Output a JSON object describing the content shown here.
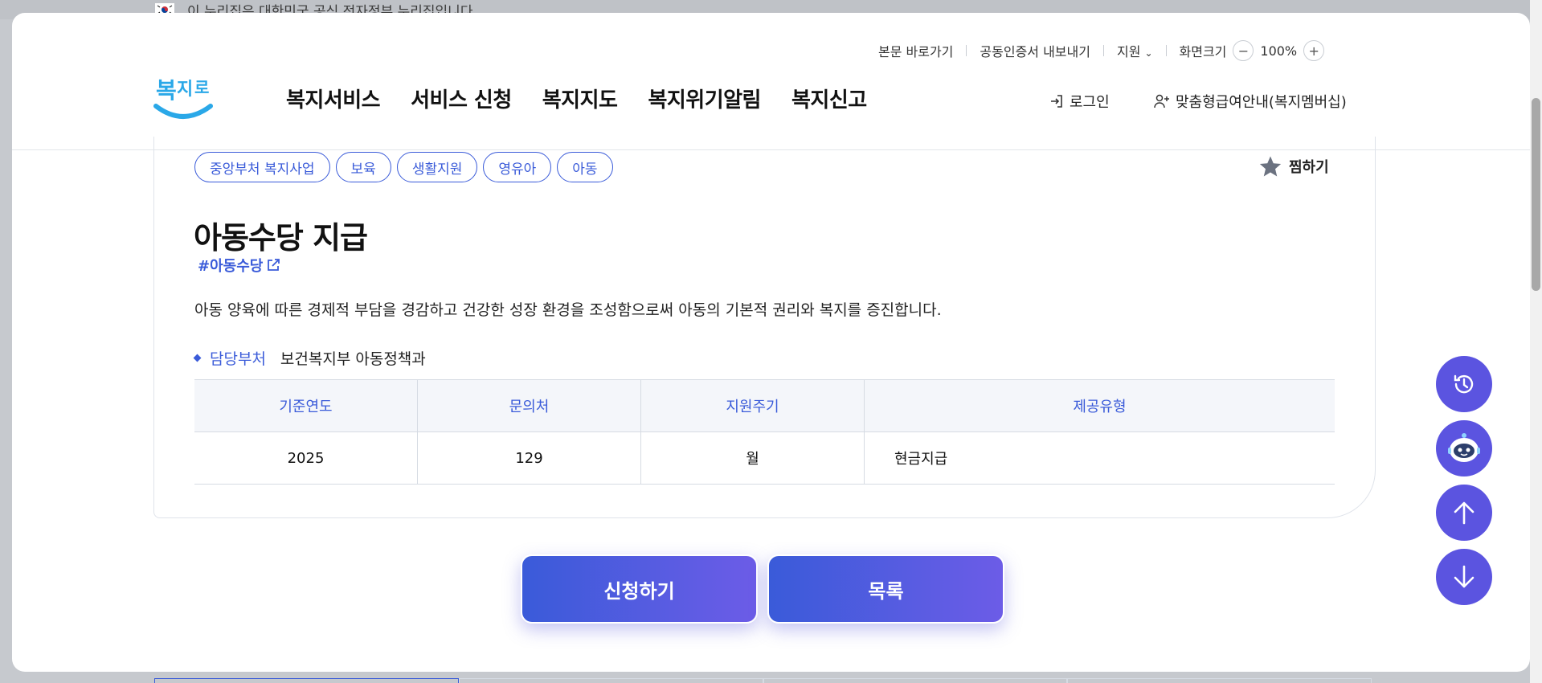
{
  "gov_banner": {
    "text": "이 누리집은 대한민국 공식 전자정부 누리집입니다."
  },
  "util_nav": {
    "skip": "본문 바로가기",
    "cert": "공동인증서 내보내기",
    "support": "지원",
    "zoom_label": "화면크기",
    "zoom_minus": "−",
    "zoom_value": "100%",
    "zoom_plus": "+"
  },
  "logo": {
    "text": "복지로"
  },
  "gnb": [
    "복지서비스",
    "서비스 신청",
    "복지지도",
    "복지위기알림",
    "복지신고"
  ],
  "header": {
    "login": "로그인",
    "membership": "맞춤형급여안내(복지멤버십)"
  },
  "tags": [
    "중앙부처 복지사업",
    "보육",
    "생활지원",
    "영유아",
    "아동"
  ],
  "favorite": "찜하기",
  "service": {
    "title": "아동수당 지급",
    "hashtag": "#아동수당",
    "description": "아동 양육에 따른 경제적 부담을 경감하고 건강한 성장 환경을 조성함으로써 아동의 기본적 권리와 복지를 증진합니다.",
    "dept_label": "담당부처",
    "dept_value": "보건복지부 아동정책과"
  },
  "info_table": {
    "headers": [
      "기준연도",
      "문의처",
      "지원주기",
      "제공유형"
    ],
    "row": [
      "2025",
      "129",
      "월",
      "현금지급"
    ]
  },
  "buttons": {
    "apply": "신청하기",
    "list": "목록"
  },
  "colors": {
    "accent": "#3a5bd9",
    "fab": "#5b54e0",
    "gradient_end": "#6c5ce7"
  },
  "fabs": [
    "history-icon",
    "chatbot-icon",
    "arrow-up-icon",
    "arrow-down-icon"
  ]
}
